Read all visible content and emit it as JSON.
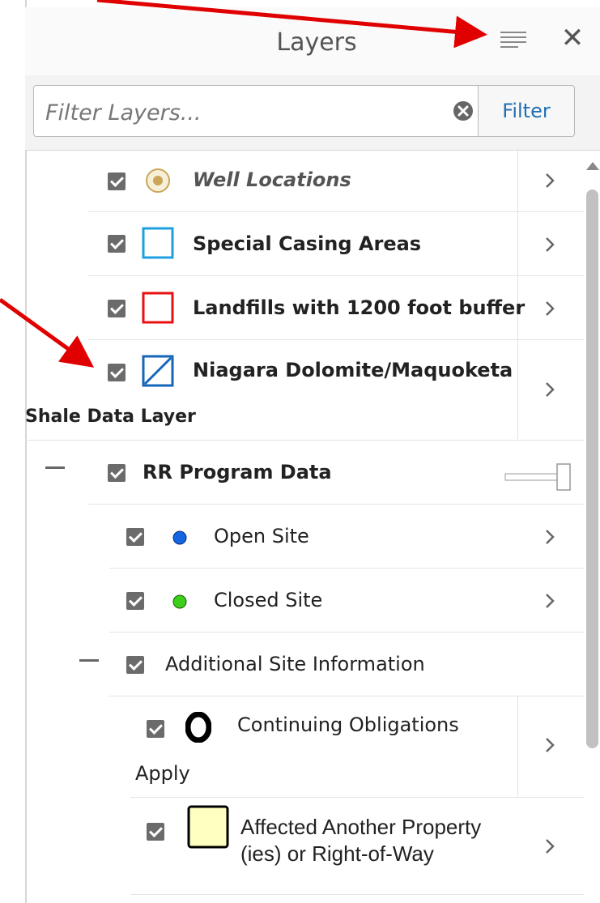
{
  "header": {
    "title": "Layers"
  },
  "filter": {
    "placeholder": "Filter Layers...",
    "button_label": "Filter"
  },
  "layers": [
    {
      "label": "Well Locations",
      "checked": true,
      "icon": "well-point-icon"
    },
    {
      "label": "Special Casing Areas",
      "checked": true,
      "icon": "blue-square-icon"
    },
    {
      "label": "Landfills with 1200 foot buffer",
      "checked": true,
      "icon": "red-square-icon"
    },
    {
      "label_line1": "Niagara Dolomite/Maquoketa",
      "label_line2": "Shale Data Layer",
      "checked": true,
      "icon": "blue-hatched-square-icon"
    }
  ],
  "group": {
    "label": "RR Program Data",
    "checked": true,
    "children": [
      {
        "label": "Open Site",
        "checked": true,
        "icon": "blue-dot-icon",
        "color": "#1565e0"
      },
      {
        "label": "Closed Site",
        "checked": true,
        "icon": "green-dot-icon",
        "color": "#3ccf1a"
      }
    ],
    "subgroup": {
      "label": "Additional Site Information",
      "checked": true,
      "children": [
        {
          "label_line1": "Continuing Obligations",
          "label_line2": "Apply",
          "checked": true,
          "icon": "black-o-icon"
        },
        {
          "label_line1": "Affected Another Property",
          "label_line2": "(ies) or Right-of-Way",
          "checked": true,
          "icon": "yellow-square-icon",
          "color": "#ffffc0"
        }
      ]
    }
  },
  "colors": {
    "annotation_arrow": "#e00000",
    "link_blue": "#1f6fb5"
  }
}
